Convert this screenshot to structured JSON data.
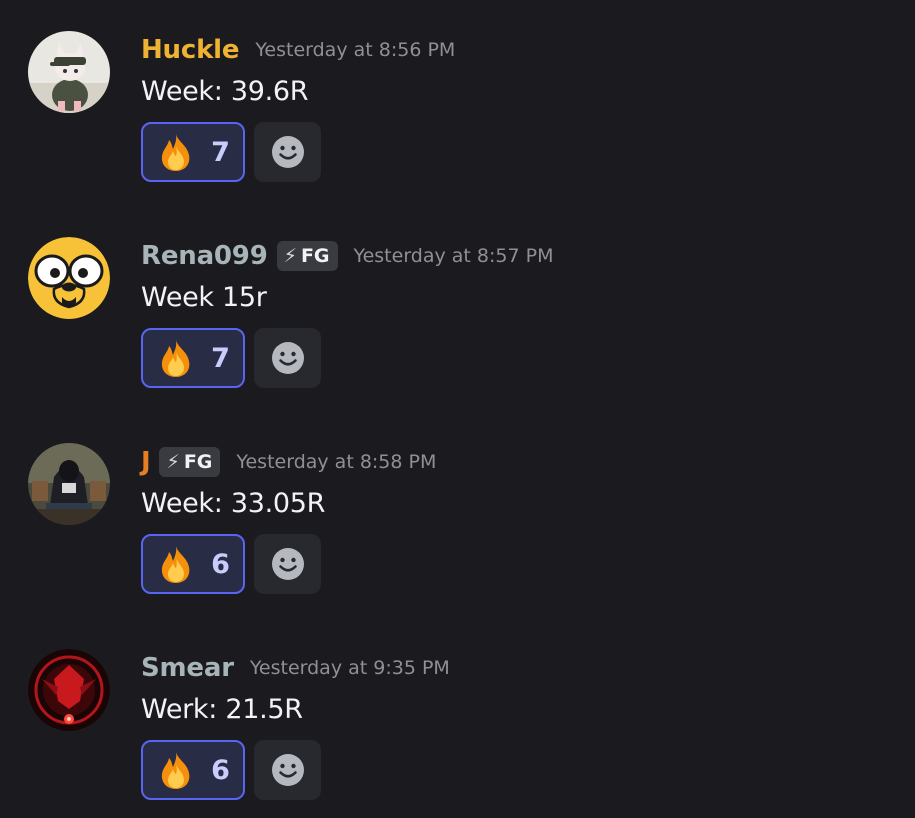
{
  "colors": {
    "background": "#1b1b1f",
    "reaction_active_border": "#5865f2",
    "reaction_active_bg": "#292c45",
    "timestamp": "#8e9096"
  },
  "messages": [
    {
      "username": "Huckle",
      "username_color": "#f0b232",
      "avatar": "cat-in-hoodie-avatar",
      "tag": null,
      "timestamp": "Yesterday at 8:56 PM",
      "content": "Week: 39.6R",
      "reaction": {
        "emoji": "fire-icon",
        "count": "7"
      }
    },
    {
      "username": "Rena099",
      "username_color": "#a7b4b8",
      "avatar": "jake-the-dog-avatar",
      "tag": {
        "icon": "lightning-icon",
        "label": "FG"
      },
      "timestamp": "Yesterday at 8:57 PM",
      "content": "Week 15r",
      "reaction": {
        "emoji": "fire-icon",
        "count": "7"
      }
    },
    {
      "username": "J",
      "username_color": "#e67e22",
      "avatar": "hooded-figure-avatar",
      "tag": {
        "icon": "lightning-icon",
        "label": "FG"
      },
      "timestamp": "Yesterday at 8:58 PM",
      "content": "Week: 33.05R",
      "reaction": {
        "emoji": "fire-icon",
        "count": "6"
      }
    },
    {
      "username": "Smear",
      "username_color": "#a7b4b8",
      "avatar": "red-emblem-avatar",
      "tag": null,
      "timestamp": "Yesterday at 9:35 PM",
      "content": "Werk: 21.5R",
      "reaction": {
        "emoji": "fire-icon",
        "count": "6"
      }
    }
  ]
}
